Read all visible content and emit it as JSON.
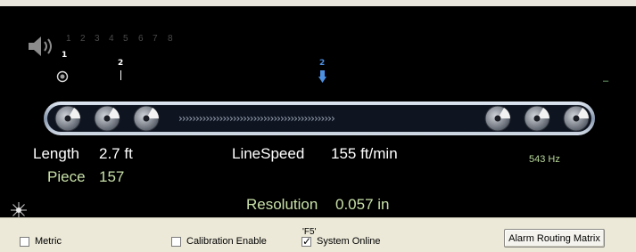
{
  "channels": [
    "1",
    "2",
    "3",
    "4",
    "5",
    "6",
    "7",
    "8"
  ],
  "markers": {
    "m1_label": "1",
    "m2_label": "2",
    "m3_label": "2",
    "right_dash": "–"
  },
  "conveyor": {
    "arrows": "››››››››››››››››››››››››››››››››››››››››››››››"
  },
  "stats": {
    "length_label": "Length",
    "length_value": "2.7 ft",
    "piece_label": "Piece",
    "piece_value": "157",
    "linespeed_label": "LineSpeed",
    "linespeed_value": "155 ft/min",
    "resolution_label": "Resolution",
    "resolution_value": "0.057 in",
    "frequency": "543 Hz"
  },
  "controls": {
    "metric_label": "Metric",
    "metric_checked": false,
    "calibration_label": "Calibration Enable",
    "calibration_checked": false,
    "f5_label": "'F5'",
    "system_online_label": "System Online",
    "system_online_checked": true,
    "alarm_button_label": "Alarm Routing Matrix"
  },
  "colors": {
    "display_bg": "#000000",
    "panel_bg": "#ece9d8",
    "green_text": "#c8e0a8",
    "marker_blue": "#4d8fe0"
  }
}
